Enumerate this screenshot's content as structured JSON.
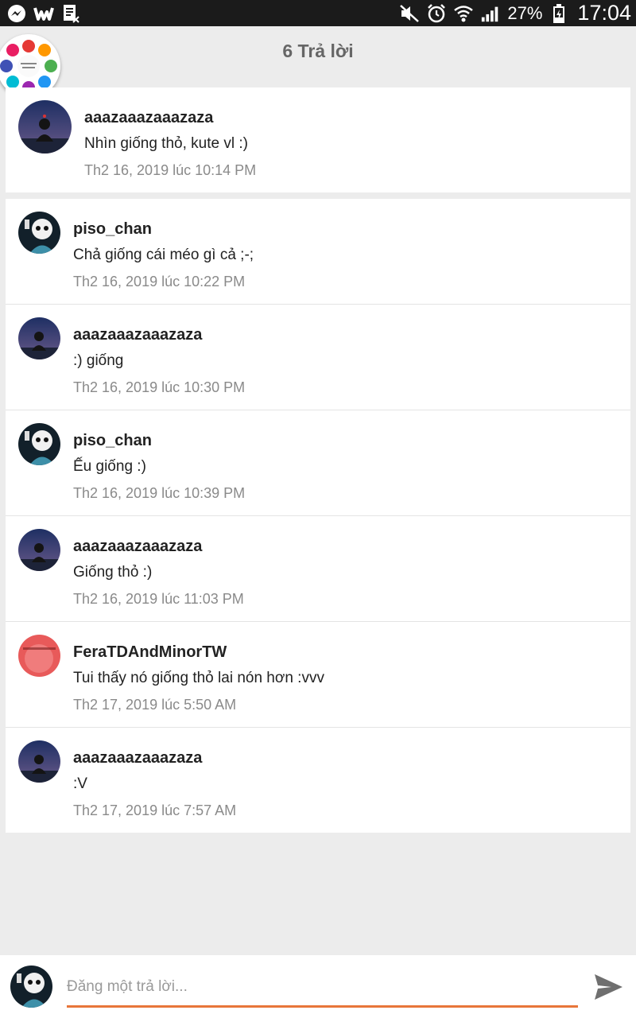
{
  "status_bar": {
    "battery": "27%",
    "time": "17:04",
    "icons": [
      "messenger-icon",
      "wattpad-icon",
      "document-icon",
      "mute-icon",
      "alarm-icon",
      "wifi-icon",
      "signal-icon",
      "battery-icon"
    ]
  },
  "header": {
    "title": "6 Trả lời"
  },
  "parent_comment": {
    "username": "aaazaaazaaazaza",
    "text": "Nhìn giống thỏ, kute vl :)",
    "time": "Th2 16, 2019 lúc 10:14 PM"
  },
  "replies": [
    {
      "username": "piso_chan",
      "text": "Chả giống cái méo gì cả ;-;",
      "time": "Th2 16, 2019 lúc 10:22 PM"
    },
    {
      "username": "aaazaaazaaazaza",
      "text": ":) giống",
      "time": "Th2 16, 2019 lúc 10:30 PM"
    },
    {
      "username": "piso_chan",
      "text": "Ếu giống :)",
      "time": "Th2 16, 2019 lúc 10:39 PM"
    },
    {
      "username": "aaazaaazaaazaza",
      "text": "Giống thỏ :)",
      "time": "Th2 16, 2019 lúc 11:03 PM"
    },
    {
      "username": "FeraTDAndMinorTW",
      "text": "Tui thấy nó giống thỏ lai nón hơn :vvv",
      "time": "Th2 17, 2019 lúc 5:50 AM"
    },
    {
      "username": "aaazaaazaaazaza",
      "text": ":V",
      "time": "Th2 17, 2019 lúc 7:57 AM"
    }
  ],
  "composer": {
    "placeholder": "Đăng một trả lời..."
  },
  "colors": {
    "accent": "#e8763a",
    "background": "#ececec"
  }
}
